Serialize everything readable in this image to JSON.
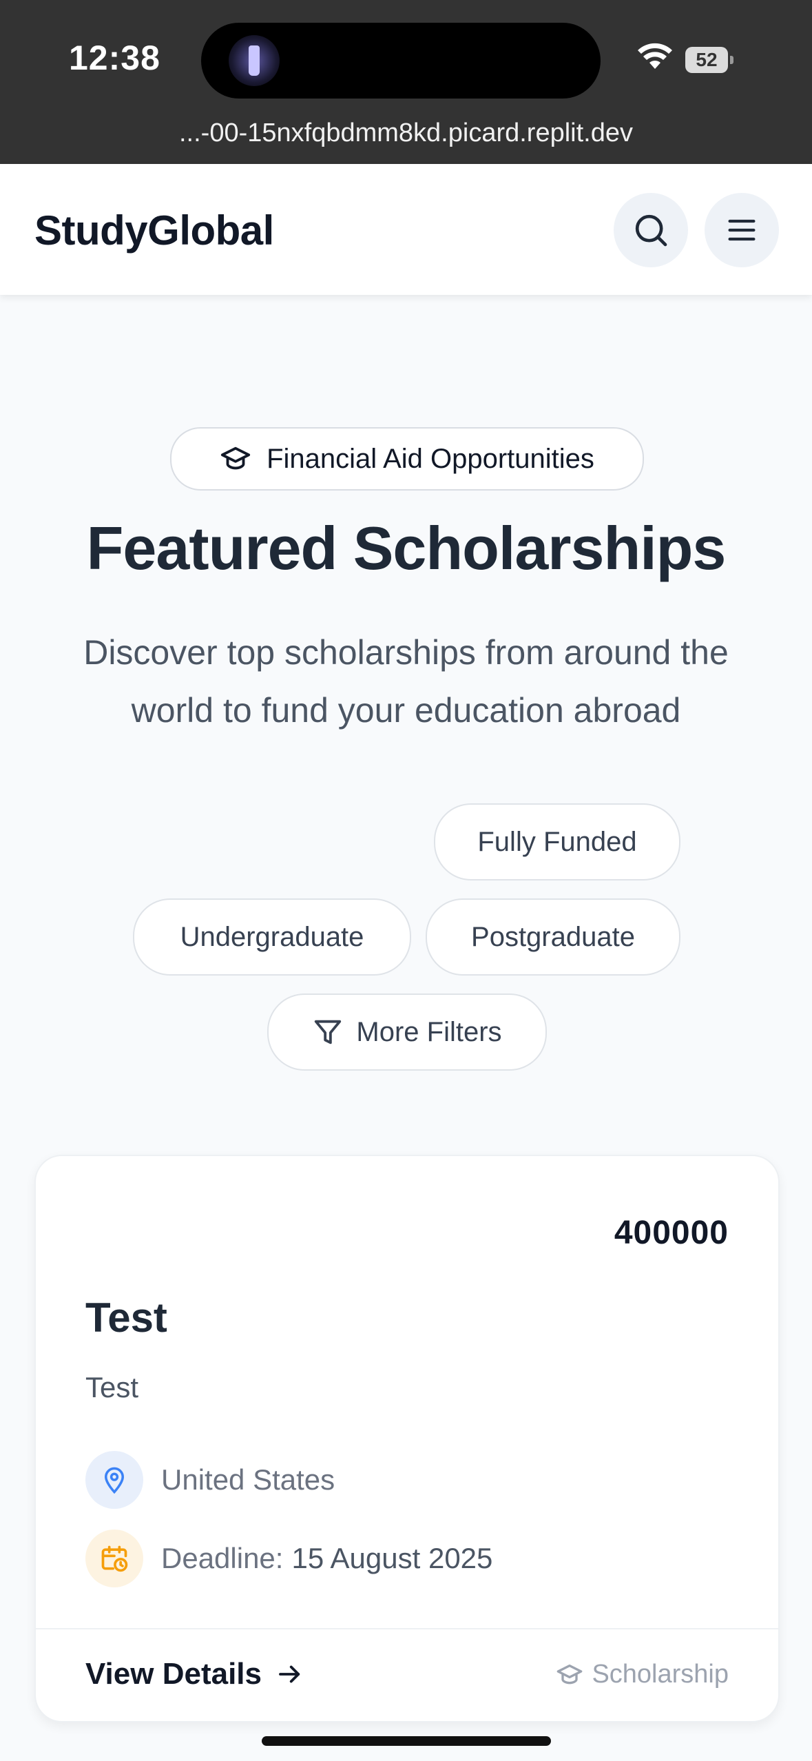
{
  "status_bar": {
    "time": "12:38",
    "battery": "52",
    "url": "...-00-15nxfqbdmm8kd.picard.replit.dev"
  },
  "header": {
    "brand": "StudyGlobal",
    "search_icon": "search-icon",
    "menu_icon": "hamburger-menu-icon"
  },
  "hero": {
    "badge": "Financial Aid Opportunities",
    "title": "Featured Scholarships",
    "subtitle": "Discover top scholarships from around the world to fund your education abroad"
  },
  "filters": {
    "chips": [
      "Fully Funded",
      "Undergraduate",
      "Postgraduate"
    ],
    "more": "More Filters"
  },
  "scholarship_card": {
    "amount": "400000",
    "title": "Test",
    "description": "Test",
    "location": "United States",
    "deadline_label": "Deadline:",
    "deadline_value": "15 August 2025",
    "cta": "View Details",
    "tag": "Scholarship"
  },
  "colors": {
    "accent_blue": "#3b82f6",
    "accent_amber": "#f59e0b",
    "text_dark": "#1f2937"
  }
}
